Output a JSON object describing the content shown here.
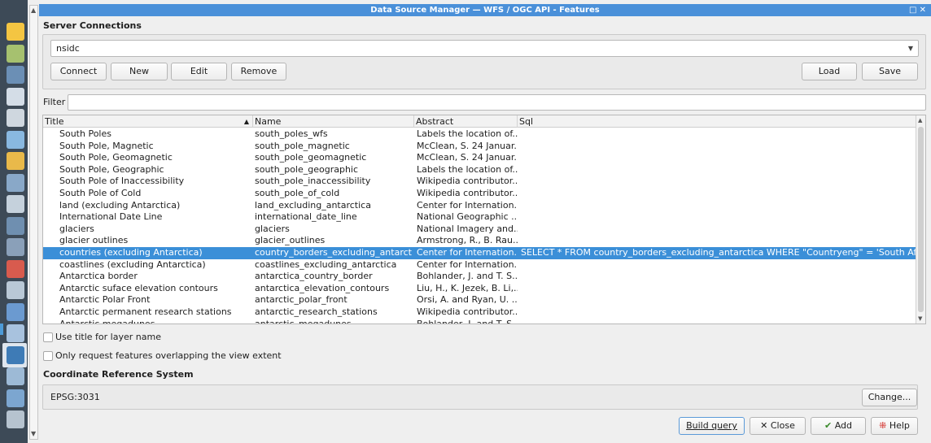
{
  "window": {
    "title": "Data Source Manager — WFS / OGC API - Features",
    "controls": "□ ✕"
  },
  "server_connections": {
    "title": "Server Connections",
    "selected_connection": "nsidc",
    "buttons": {
      "connect": "Connect",
      "new": "New",
      "edit": "Edit",
      "remove": "Remove",
      "load": "Load",
      "save": "Save"
    }
  },
  "filter": {
    "label": "Filter",
    "value": ""
  },
  "table": {
    "columns": [
      "Title",
      "Name",
      "Abstract",
      "Sql"
    ],
    "sort_indicator": "▲",
    "rows": [
      {
        "title": "South Poles",
        "name": "south_poles_wfs",
        "abstract": "Labels the location of...",
        "sql": ""
      },
      {
        "title": "South Pole, Magnetic",
        "name": "south_pole_magnetic",
        "abstract": "McClean, S. 24 Januar...",
        "sql": ""
      },
      {
        "title": "South Pole, Geomagnetic",
        "name": "south_pole_geomagnetic",
        "abstract": "McClean, S. 24 Januar...",
        "sql": ""
      },
      {
        "title": "South Pole, Geographic",
        "name": "south_pole_geographic",
        "abstract": "Labels the location of...",
        "sql": ""
      },
      {
        "title": "South Pole of Inaccessibility",
        "name": "south_pole_inaccessibility",
        "abstract": "Wikipedia contributor...",
        "sql": ""
      },
      {
        "title": "South Pole of Cold",
        "name": "south_pole_of_cold",
        "abstract": "Wikipedia contributor...",
        "sql": ""
      },
      {
        "title": "land (excluding Antarctica)",
        "name": "land_excluding_antarctica",
        "abstract": "Center for Internation...",
        "sql": ""
      },
      {
        "title": "International Date Line",
        "name": "international_date_line",
        "abstract": "National Geographic ...",
        "sql": ""
      },
      {
        "title": "glaciers",
        "name": "glaciers",
        "abstract": "National Imagery and...",
        "sql": ""
      },
      {
        "title": "glacier outlines",
        "name": "glacier_outlines",
        "abstract": "Armstrong, R., B. Rau...",
        "sql": ""
      },
      {
        "title": "countries (excluding Antarctica)",
        "name": "country_borders_excluding_antarct...",
        "abstract": "Center for Internation...",
        "sql": "SELECT * FROM country_borders_excluding_antarctica WHERE \"Countryeng\" = 'South Africa'",
        "selected": true
      },
      {
        "title": "coastlines (excluding Antarctica)",
        "name": "coastlines_excluding_antarctica",
        "abstract": "Center for Internation...",
        "sql": ""
      },
      {
        "title": "Antarctica border",
        "name": "antarctica_country_border",
        "abstract": "Bohlander, J. and T. S...",
        "sql": ""
      },
      {
        "title": "Antarctic suface elevation contours",
        "name": "antarctica_elevation_contours",
        "abstract": "Liu, H., K. Jezek, B. Li,...",
        "sql": ""
      },
      {
        "title": "Antarctic Polar Front",
        "name": "antarctic_polar_front",
        "abstract": "Orsi, A. and Ryan, U. ...",
        "sql": ""
      },
      {
        "title": "Antarctic permanent research stations",
        "name": "antarctic_research_stations",
        "abstract": "Wikipedia contributor...",
        "sql": ""
      },
      {
        "title": "Antarctic megadunes",
        "name": "antarctic_megadunes",
        "abstract": "Bohlander, J. and T. S...",
        "sql": ""
      }
    ]
  },
  "options": {
    "use_title": "Use title for layer name",
    "only_overlapping": "Only request features overlapping the view extent"
  },
  "crs": {
    "title": "Coordinate Reference System",
    "value": "EPSG:3031",
    "change_button": "Change..."
  },
  "footer_buttons": {
    "build_query": "Build query",
    "close": "Close",
    "add": "Add",
    "help": "Help"
  },
  "sidebar_icons": [
    "browser-icon",
    "vector-layer-icon",
    "raster-layer-icon",
    "mesh-layer-icon",
    "point-cloud-icon",
    "delimited-text-icon",
    "geopackage-icon",
    "gps-icon",
    "spatialite-icon",
    "postgis-icon",
    "mssql-icon",
    "oracle-icon",
    "virtual-layer-icon",
    "sap-hana-icon",
    "wms-icon",
    "wfs-icon",
    "wcs-icon",
    "xyz-icon",
    "vector-tile-icon"
  ]
}
